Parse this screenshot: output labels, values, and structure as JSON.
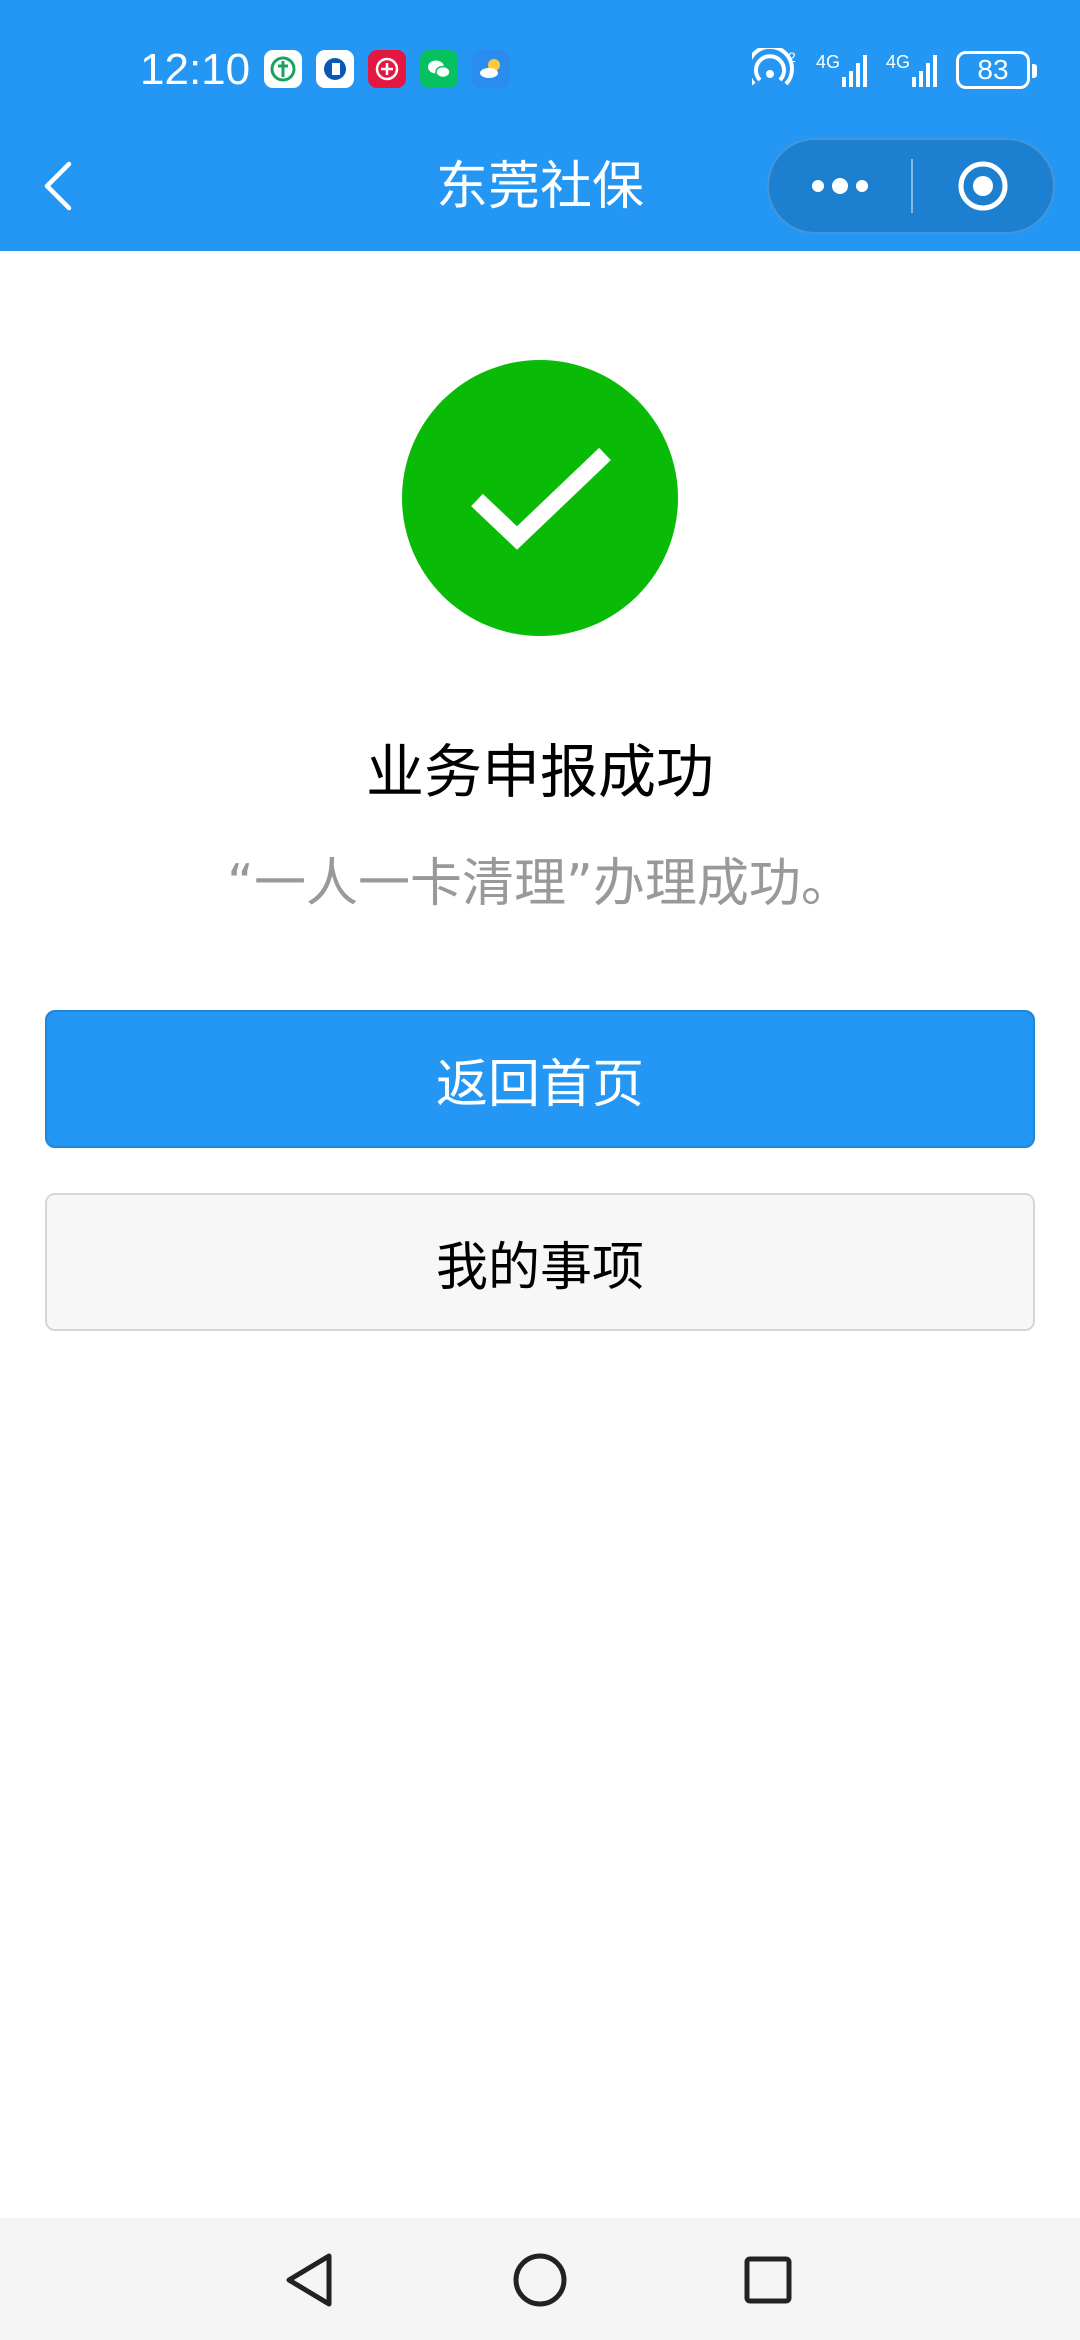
{
  "status_bar": {
    "time": "12:10",
    "battery": "83",
    "network_1": "4G",
    "network_2": "4G"
  },
  "nav": {
    "title": "东莞社保"
  },
  "result": {
    "title": "业务申报成功",
    "description": "“一人一卡清理”办理成功。",
    "status_color": "#09bb07"
  },
  "buttons": {
    "primary_label": "返回首页",
    "secondary_label": "我的事项"
  },
  "colors": {
    "brand": "#2397f3",
    "success": "#09bb07"
  }
}
